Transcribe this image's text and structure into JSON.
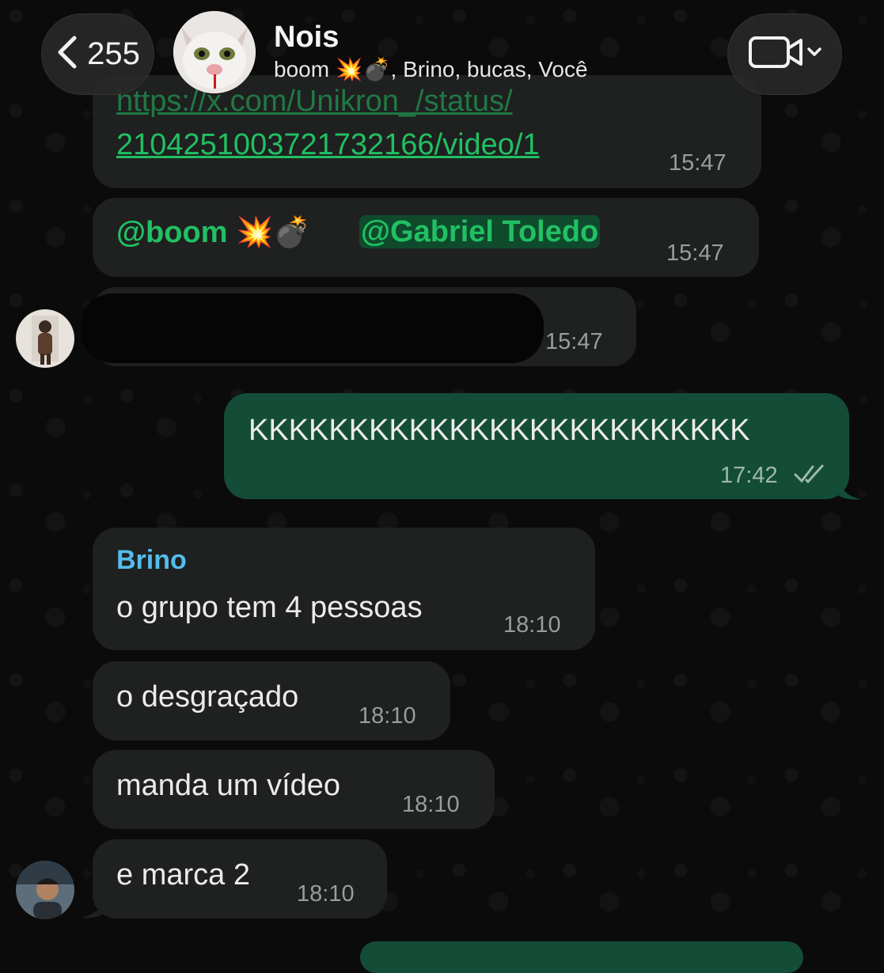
{
  "header": {
    "back_count": "255",
    "title": "Nois",
    "members": "boom 💥💣, Brino, bucas, Você",
    "back_icon": "chevron-left-icon",
    "video_icon": "video-camera-icon"
  },
  "messages": [
    {
      "link_line1": "https://x.com/Unikron_/status/",
      "link_line2": "2104251003721732166/video/1",
      "time": "15:47"
    },
    {
      "mention1": "@boom 💥💣",
      "mention2": "@Gabriel Toledo",
      "time": "15:47"
    },
    {
      "time": "15:47"
    },
    {
      "text": "KKKKKKKKKKKKKKKKKKKKKKKKK",
      "time": "17:42"
    },
    {
      "sender": "Brino",
      "text": "o grupo tem 4 pessoas",
      "time": "18:10"
    },
    {
      "text": "o desgraçado",
      "time": "18:10"
    },
    {
      "text": "manda um vídeo",
      "time": "18:10"
    },
    {
      "text": "e marca 2",
      "time": "18:10"
    }
  ],
  "colors": {
    "background": "#0b0b0b",
    "incoming_bubble": "#1f2020",
    "outgoing_bubble": "#144d37",
    "accent_green": "#21c063",
    "sender_blue": "#53bdeb"
  }
}
